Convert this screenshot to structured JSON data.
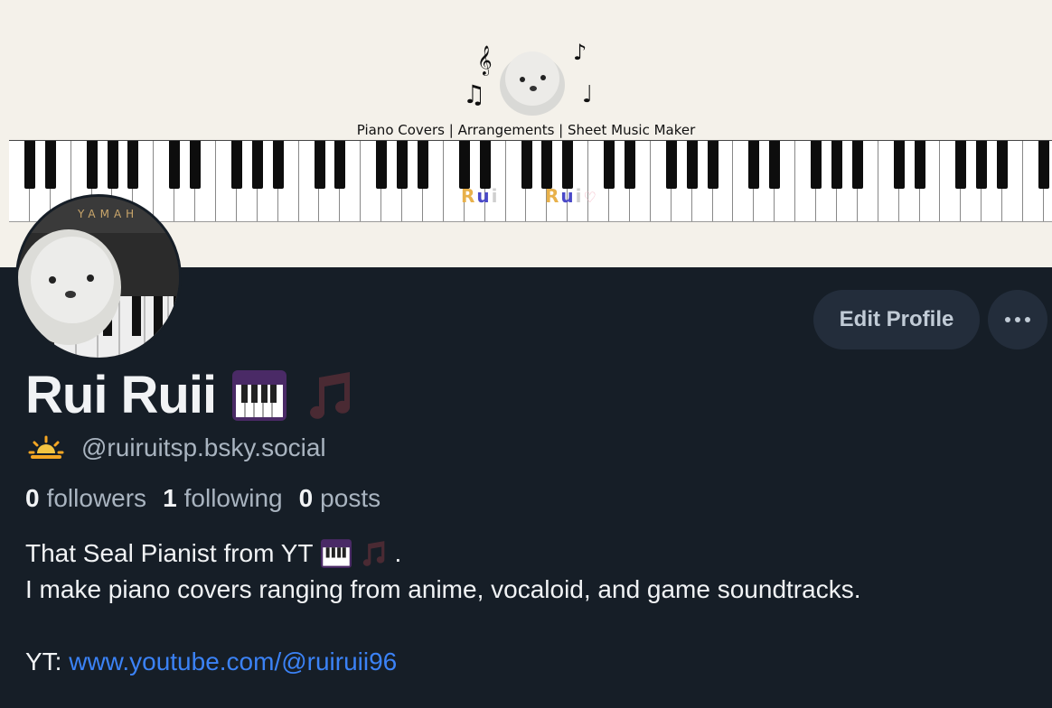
{
  "banner": {
    "tagline": "Piano Covers | Arrangements | Sheet Music Maker",
    "rui_left": [
      "R",
      "u",
      "i"
    ],
    "rui_right": [
      "R",
      "u",
      "i"
    ]
  },
  "profile": {
    "display_name": "Rui Ruii",
    "handle": "@ruiruitsp.bsky.social",
    "handle_icon": "sun-behind-cloud-icon",
    "name_icons": [
      "piano-keys-icon",
      "music-notes-icon"
    ]
  },
  "actions": {
    "edit_label": "Edit Profile",
    "more_icon": "ellipsis-icon"
  },
  "stats": {
    "followers_count": "0",
    "followers_label": "followers",
    "following_count": "1",
    "following_label": "following",
    "posts_count": "0",
    "posts_label": "posts"
  },
  "bio": {
    "line1": "That Seal Pianist from YT",
    "line1_end": ".",
    "line2": "I make piano covers ranging from anime, vocaloid, and game soundtracks.",
    "link_prefix": "YT: ",
    "link_text": "www.youtube.com/@ruiruii96"
  },
  "avatar": {
    "piano_brand": "YAMAH"
  },
  "colors": {
    "background": "#161e27",
    "button": "#232d3b",
    "link": "#3b82f6",
    "banner": "#f4f1ea"
  }
}
